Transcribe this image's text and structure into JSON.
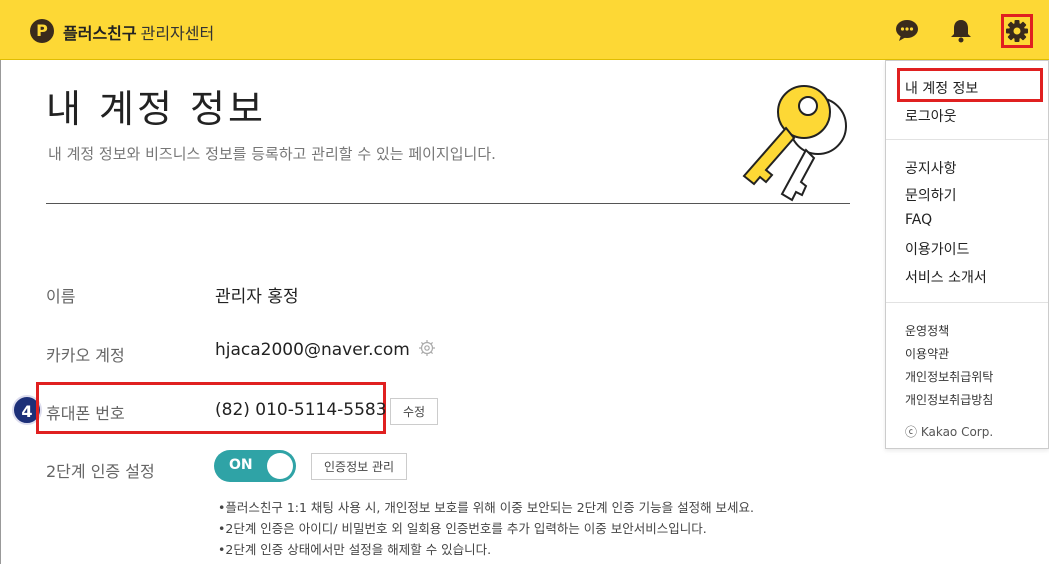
{
  "header": {
    "logo_letter": "P",
    "brand": "플러스친구",
    "brand_sub": "관리자센터",
    "icons": [
      "chat-icon",
      "bell-icon",
      "gear-icon"
    ],
    "accent_color": "#fdd835",
    "highlight_color": "#e02020"
  },
  "page": {
    "title": "내 계정 정보",
    "description": "내 계정 정보와 비즈니스 정보를 등록하고 관리할 수 있는 페이지입니다."
  },
  "rows": {
    "name": {
      "label": "이름",
      "value": "관리자 홍정"
    },
    "kakao": {
      "label": "카카오 계정",
      "value": "hjaca2000@naver.com"
    },
    "phone": {
      "label": "휴대폰 번호",
      "value": "(82) 010-5114-5583",
      "button": "수정"
    },
    "twofa": {
      "label": "2단계 인증 설정",
      "toggle": "ON",
      "button": "인증정보 관리"
    }
  },
  "step_badge": "4",
  "notes": [
    "•플러스친구 1:1 채팅 사용 시, 개인정보 보호를 위해 이중 보안되는 2단계 인증 기능을 설정해 보세요.",
    "•2단계 인증은 아이디/ 비밀번호 외 일회용 인증번호를 추가 입력하는 이중 보안서비스입니다.",
    "•2단계 인증 상태에서만 설정을 해제할 수 있습니다."
  ],
  "menu": {
    "group1": [
      "내 계정 정보",
      "로그아웃"
    ],
    "group2": [
      "공지사항",
      "문의하기",
      "FAQ",
      "이용가이드",
      "서비스 소개서"
    ],
    "group3": [
      "운영정책",
      "이용약관",
      "개인정보취급위탁",
      "개인정보취급방침"
    ],
    "copyright": "ⓒ Kakao Corp."
  }
}
